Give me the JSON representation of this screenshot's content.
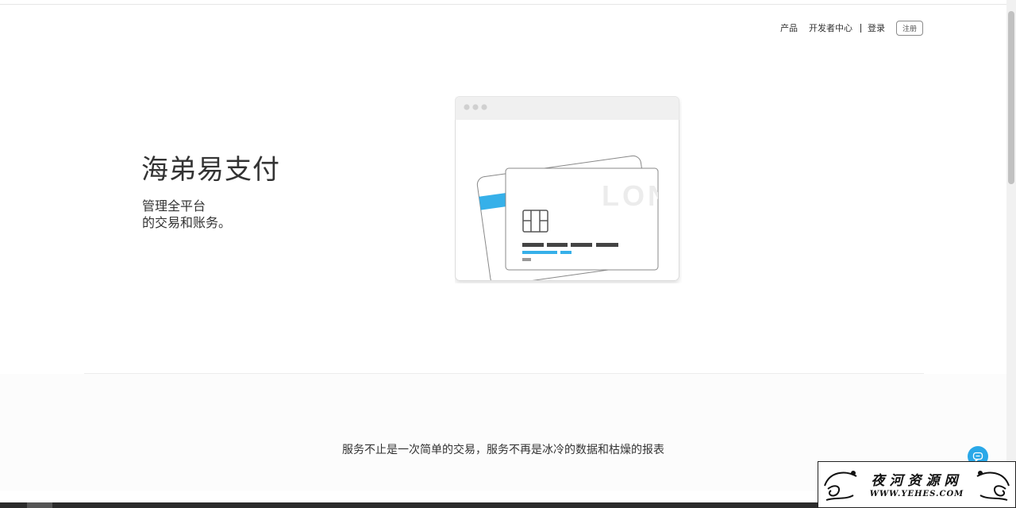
{
  "nav": {
    "products": "产品",
    "developer_center": "开发者中心",
    "login": "登录",
    "register": "注册"
  },
  "hero": {
    "title": "海弟易支付",
    "subtitle_line1": "管理全平台",
    "subtitle_line2": "的交易和账务。"
  },
  "illustration": {
    "card_text": "LON",
    "accent_color": "#36b0e9"
  },
  "section": {
    "tagline": "服务不止是一次简单的交易，服务不再是冰冷的数据和枯燥的报表"
  },
  "watermark": {
    "title": "夜河资源网",
    "url": "WWW.YEHES.COM"
  },
  "icons": {
    "chat": "chat-bubble-icon"
  }
}
